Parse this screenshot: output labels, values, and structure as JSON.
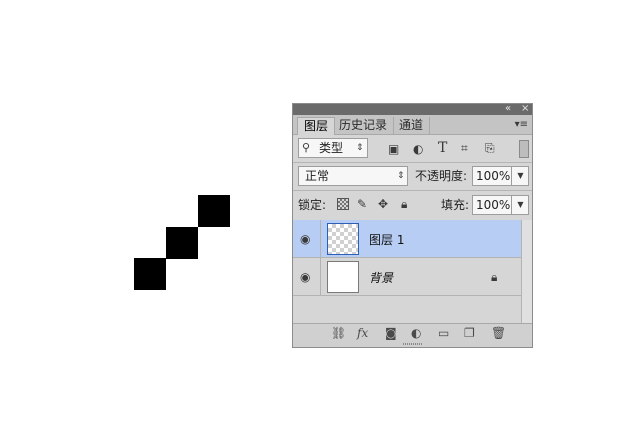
{
  "canvas": {
    "shape_color": "#000000"
  },
  "panel": {
    "collapse_icon": "double-chevron-left-icon",
    "close_icon": "close-icon",
    "tabs": [
      {
        "label": "图层"
      },
      {
        "label": "历史记录"
      },
      {
        "label": "通道"
      }
    ],
    "menu_icon": "panel-menu-icon",
    "filter": {
      "search_icon": "search-icon",
      "kind_label": "类型",
      "filter_icons": [
        "image-filter-icon",
        "adjustment-filter-icon",
        "type-filter-icon",
        "shape-filter-icon",
        "smart-object-filter-icon"
      ]
    },
    "blend": {
      "mode": "正常",
      "opacity_label": "不透明度:",
      "opacity_value": "100%"
    },
    "lock": {
      "lock_label": "锁定:",
      "fill_label": "填充:",
      "fill_value": "100%"
    },
    "layers": [
      {
        "name": "图层 1",
        "selected": true,
        "transparent": true
      },
      {
        "name": "背景",
        "selected": false,
        "locked": true
      }
    ],
    "footer_icons": [
      "link-icon",
      "fx-icon",
      "mask-icon",
      "adjustment-layer-icon",
      "group-folder-icon",
      "new-layer-icon",
      "trash-icon"
    ],
    "fx_label": "fx",
    "colors": {
      "selected_row": "#b8cdf3",
      "titlebar": "#6a6a6a",
      "panel_bg": "#d6d6d6"
    }
  }
}
